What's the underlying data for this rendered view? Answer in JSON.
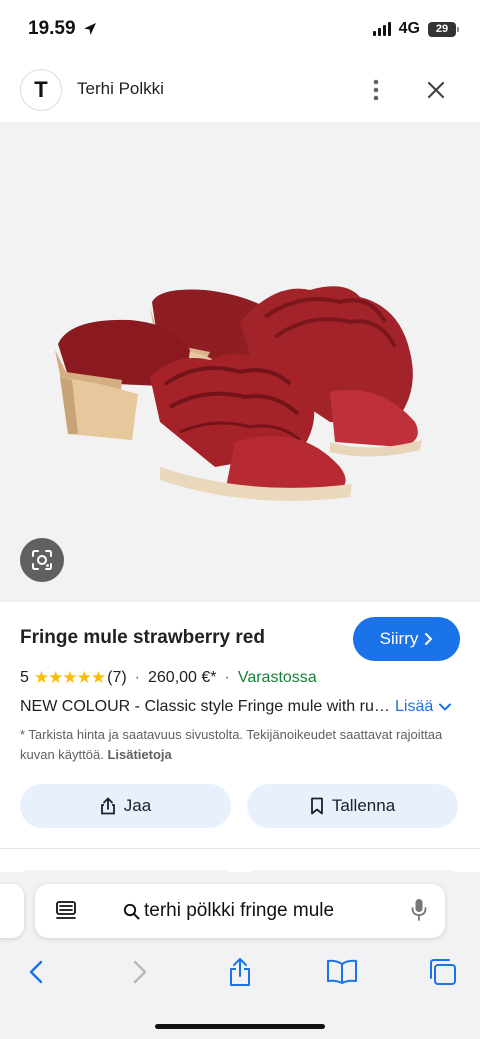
{
  "status_bar": {
    "time": "19.59",
    "network": "4G",
    "battery": "29"
  },
  "header": {
    "avatar_letter": "T",
    "site_name": "Terhi Polkki"
  },
  "product": {
    "title": "Fringe mule strawberry red",
    "go_button": "Siirry",
    "rating": "5",
    "stars": "★★★★★",
    "review_count": "(7)",
    "price": "260,00 €*",
    "availability": "Varastossa",
    "description": "NEW COLOUR - Classic style Fringe mule with ruffle detail",
    "more_label": "Lisää",
    "disclaimer": "* Tarkista hinta ja saatavuus sivustolta. Tekijänoikeudet saattavat rajoittaa kuvan käyttöä.",
    "disclaimer_link": "Lisätietoja",
    "share_label": "Jaa",
    "save_label": "Tallenna"
  },
  "browser": {
    "search_query": "terhi pölkki fringe mule"
  },
  "colors": {
    "accent": "#1a73e8",
    "in_stock": "#188038",
    "stars": "#fbbc04",
    "chip_bg": "#e8f0fe",
    "shoe_red": "#b0272f"
  }
}
